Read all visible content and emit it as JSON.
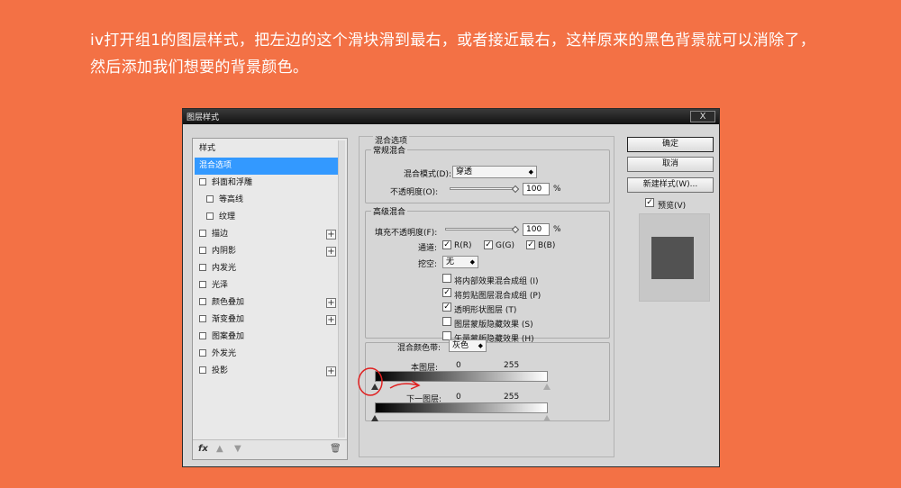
{
  "instruction": "iv打开组1的图层样式，把左边的这个滑块滑到最右，或者接近最右，这样原来的黑色背景就可以消除了，然后添加我们想要的背景颜色。",
  "dialog": {
    "title": "图层样式",
    "close": "X",
    "styles": {
      "items": [
        {
          "label": "样式"
        },
        {
          "label": "混合选项"
        },
        {
          "label": "斜面和浮雕"
        },
        {
          "label": "等高线"
        },
        {
          "label": "纹理"
        },
        {
          "label": "描边"
        },
        {
          "label": "内阴影"
        },
        {
          "label": "内发光"
        },
        {
          "label": "光泽"
        },
        {
          "label": "颜色叠加"
        },
        {
          "label": "渐变叠加"
        },
        {
          "label": "图案叠加"
        },
        {
          "label": "外发光"
        },
        {
          "label": "投影"
        }
      ],
      "footer_fx": "fx",
      "footer_up": "▲",
      "footer_down": "▼",
      "footer_trash": "🗑",
      "plus": "+"
    },
    "blending": {
      "section_title": "混合选项",
      "general": {
        "group_title": "常规混合",
        "mode_label": "混合模式(D):",
        "mode_value": "穿透",
        "opacity_label": "不透明度(O):",
        "opacity_value": "100",
        "percent": "%"
      },
      "advanced": {
        "group_title": "高级混合",
        "fill_label": "填充不透明度(F):",
        "fill_value": "100",
        "percent": "%",
        "channels_label": "通道:",
        "channel_r": "R(R)",
        "channel_g": "G(G)",
        "channel_b": "B(B)",
        "knockout_label": "挖空:",
        "knockout_value": "无",
        "opt1": "将内部效果混合成组 (I)",
        "opt2": "将剪贴图层混合成组 (P)",
        "opt3": "透明形状图层 (T)",
        "opt4": "图层蒙版隐藏效果 (S)",
        "opt5": "矢量蒙版隐藏效果 (H)",
        "checked": [
          false,
          true,
          true,
          false,
          false
        ]
      },
      "blend_if": {
        "label": "混合颜色带:",
        "value": "灰色",
        "this_layer_label": "本图层:",
        "this_min": "0",
        "this_max": "255",
        "under_layer_label": "下一图层:",
        "under_min": "0",
        "under_max": "255"
      }
    },
    "buttons": {
      "ok": "确定",
      "cancel": "取消",
      "new_style": "新建样式(W)...",
      "preview_label": "预览(V)",
      "check": "✓"
    },
    "annotation_color": "#e02020"
  }
}
